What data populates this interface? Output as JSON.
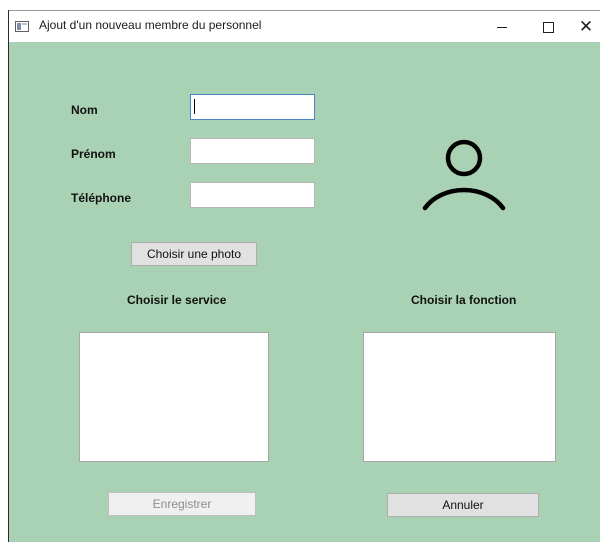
{
  "window": {
    "title": "Ajout d'un nouveau membre du personnel",
    "minimize_glyph": "—",
    "close_glyph": "✕"
  },
  "form": {
    "nom_label": "Nom",
    "prenom_label": "Prénom",
    "telephone_label": "Téléphone",
    "nom_value": "",
    "prenom_value": "",
    "telephone_value": ""
  },
  "photo": {
    "button_label": "Choisir une photo",
    "placeholder_icon": "user-icon"
  },
  "service": {
    "label": "Choisir le service",
    "items": []
  },
  "fonction": {
    "label": "Choisir la fonction",
    "items": []
  },
  "actions": {
    "save_label": "Enregistrer",
    "save_enabled": false,
    "cancel_label": "Annuler"
  },
  "colors": {
    "background": "#a9d2b4",
    "focus_border": "#4b86c4"
  }
}
